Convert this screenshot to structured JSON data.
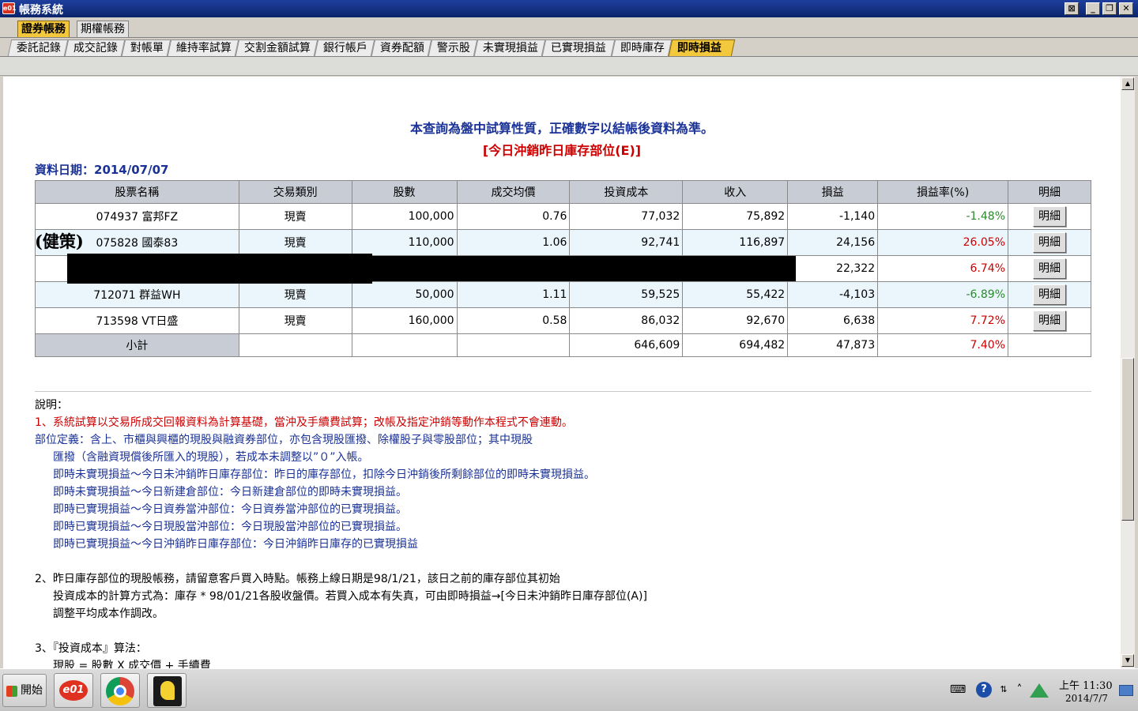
{
  "window": {
    "app_icon": "e01-app-icon",
    "title": "帳務系統",
    "buttons": [
      "minimize",
      "restore",
      "close"
    ],
    "extra_btn": "⊠"
  },
  "tabs_main": [
    {
      "label": "證券帳務",
      "active": true
    },
    {
      "label": "期權帳務",
      "active": false
    }
  ],
  "tabs_sub": [
    {
      "label": "委託記錄",
      "active": false
    },
    {
      "label": "成交記錄",
      "active": false
    },
    {
      "label": "對帳單",
      "active": false
    },
    {
      "label": "維持率試算",
      "active": false
    },
    {
      "label": "交割金額試算",
      "active": false
    },
    {
      "label": "銀行帳戶",
      "active": false
    },
    {
      "label": "資券配額",
      "active": false
    },
    {
      "label": "警示股",
      "active": false
    },
    {
      "label": "未實現損益",
      "active": false
    },
    {
      "label": "已實現損益",
      "active": false
    },
    {
      "label": "即時庫存",
      "active": false
    },
    {
      "label": "即時損益",
      "active": true
    }
  ],
  "notice": "本查詢為盤中試算性質，正確數字以結帳後資料為準。",
  "subnotice": "[今日沖銷昨日庫存部位(E)]",
  "date_line": "資料日期：2014/07/07",
  "handwritten_note": "(健策)",
  "table": {
    "headers": [
      "股票名稱",
      "交易類別",
      "股數",
      "成交均價",
      "投資成本",
      "收入",
      "損益",
      "損益率(%)",
      "明細"
    ],
    "rows": [
      {
        "name": "074937 富邦FZ",
        "type": "現賣",
        "shares": "100,000",
        "avg_price": "0.76",
        "cost": "77,032",
        "income": "75,892",
        "pl": "-1,140",
        "pl_rate": "-1.48%",
        "sign": "neg",
        "detail": "明細",
        "redacted": false
      },
      {
        "name": "075828 國泰83",
        "type": "現賣",
        "shares": "110,000",
        "avg_price": "1.06",
        "cost": "92,741",
        "income": "116,897",
        "pl": "24,156",
        "pl_rate": "26.05%",
        "sign": "pos",
        "detail": "明細",
        "redacted": false
      },
      {
        "name": "",
        "type": "",
        "shares": "",
        "avg_price": "",
        "cost": "",
        "income": "",
        "pl": "22,322",
        "pl_rate": "6.74%",
        "sign": "pos",
        "detail": "明細",
        "redacted": true
      },
      {
        "name": "712071 群益WH",
        "type": "現賣",
        "shares": "50,000",
        "avg_price": "1.11",
        "cost": "59,525",
        "income": "55,422",
        "pl": "-4,103",
        "pl_rate": "-6.89%",
        "sign": "neg",
        "detail": "明細",
        "redacted": false
      },
      {
        "name": "713598 VT日盛",
        "type": "現賣",
        "shares": "160,000",
        "avg_price": "0.58",
        "cost": "86,032",
        "income": "92,670",
        "pl": "6,638",
        "pl_rate": "7.72%",
        "sign": "pos",
        "detail": "明細",
        "redacted": false
      }
    ],
    "subtotal": {
      "label": "小計",
      "cost": "646,609",
      "income": "694,482",
      "pl": "47,873",
      "pl_rate": "7.40%"
    }
  },
  "notes": {
    "heading": "說明：",
    "n1": "1、系統試算以交易所成交回報資料為計算基礎，當沖及手續費試算；改帳及指定沖銷等動作本程式不會連動。",
    "def1": "部位定義：含上、市櫃與興櫃的現股與融資券部位，亦包含現股匯撥、除權股子與零股部位；其中現股",
    "def2": "匯撥（含融資現償後所匯入的現股），若成本未調整以”０”入帳。",
    "def3": "即時未實現損益～今日未沖銷昨日庫存部位：昨日的庫存部位，扣除今日沖銷後所剩餘部位的即時未實現損益。",
    "def4": "即時未實現損益～今日新建倉部位：今日新建倉部位的即時未實現損益。",
    "def5": "即時已實現損益～今日資券當沖部位：今日資券當沖部位的已實現損益。",
    "def6": "即時已實現損益～今日現股當沖部位：今日現股當沖部位的已實現損益。",
    "def7": "即時已實現損益～今日沖銷昨日庫存部位：今日沖銷昨日庫存的已實現損益",
    "n2a": "2、昨日庫存部位的現股帳務，請留意客戶買入時點。帳務上線日期是98/1/21，該日之前的庫存部位其初始",
    "n2b": "投資成本的計算方式為：庫存 * 98/01/21各股收盤價。若買入成本有失真，可由即時損益→[今日未沖銷昨日庫存部位(A)]",
    "n2c": "調整平均成本作調改。",
    "n3a": "3、『投資成本』算法：",
    "n3b": "現股 = 股數 X 成交價 + 手續費"
  },
  "taskbar": {
    "start_label": "開始",
    "apps": [
      "e01-app-icon",
      "chrome-icon",
      "yellow-app-icon"
    ],
    "tray": [
      "keyboard-icon",
      "help-icon",
      "network-icon",
      "chevron-up-icon",
      "google-drive-icon"
    ],
    "clock_time": "上午 11:30",
    "clock_date": "2014/7/7"
  }
}
